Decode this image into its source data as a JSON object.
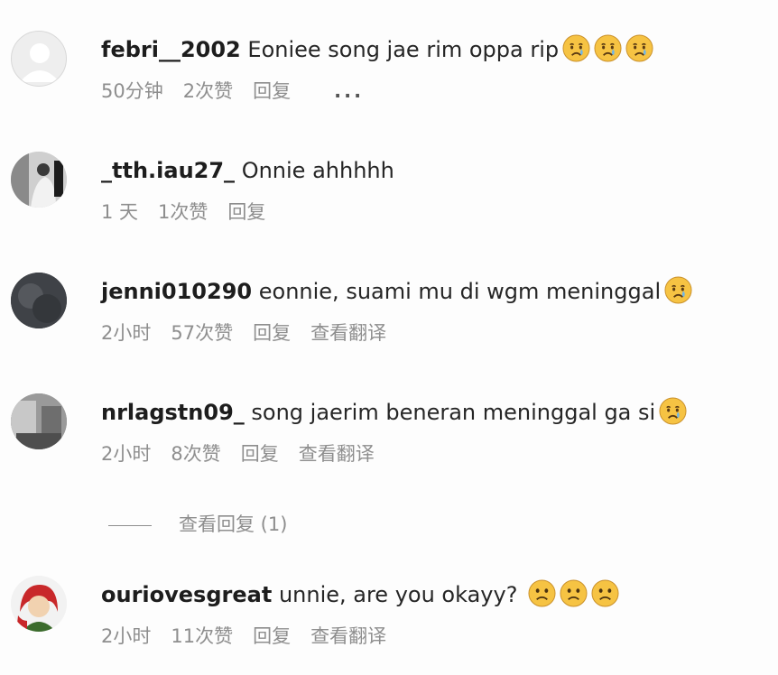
{
  "comments": [
    {
      "username": "febri__2002",
      "text": "Eoniee song jae rim oppa rip",
      "emojis": [
        "crying-face-emoji",
        "crying-face-emoji",
        "crying-face-emoji"
      ],
      "time": "50分钟",
      "likes": "2次赞",
      "reply": "回复",
      "more": "..."
    },
    {
      "username": "_tth.iau27_",
      "text": "Onnie ahhhhh",
      "emojis": [],
      "time": "1 天",
      "likes": "1次赞",
      "reply": "回复"
    },
    {
      "username": "jenni010290",
      "text": "eonnie, suami mu di wgm meninggal",
      "emojis": [
        "crying-face-emoji"
      ],
      "time": "2小时",
      "likes": "57次赞",
      "reply": "回复",
      "translate": "查看翻译"
    },
    {
      "username": "nrlagstn09_",
      "text": "song jaerim beneran meninggal ga si",
      "emojis": [
        "crying-face-emoji"
      ],
      "time": "2小时",
      "likes": "8次赞",
      "reply": "回复",
      "translate": "查看翻译"
    },
    {
      "username": "ouriovesgreat",
      "text": "unnie, are you okayy?",
      "emojis": [
        "slightly-frowning-face-emoji",
        "slightly-frowning-face-emoji",
        "slightly-frowning-face-emoji"
      ],
      "time": "2小时",
      "likes": "11次赞",
      "reply": "回复",
      "translate": "查看翻译"
    }
  ],
  "view_replies": "查看回复 (1)",
  "colors": {
    "meta_text": "#8e8e8e",
    "username": "#1d1d1d",
    "emoji_yellow": "#f6c343",
    "tear_blue": "#6fb6e8"
  }
}
